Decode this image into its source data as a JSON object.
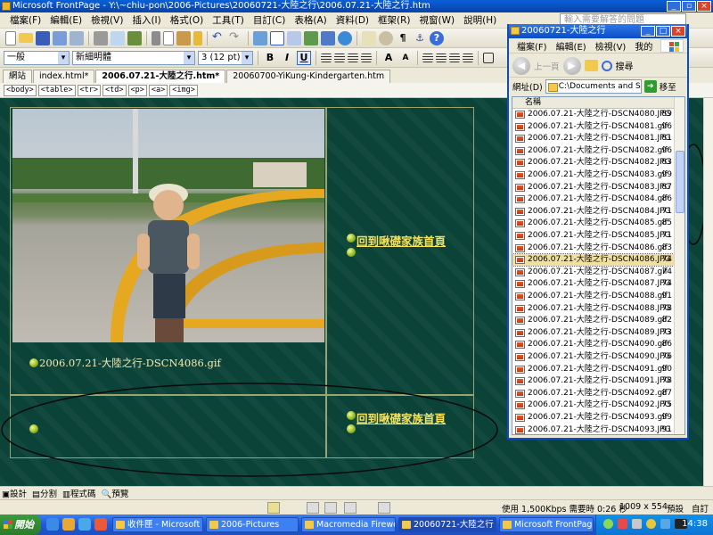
{
  "window": {
    "title": "Microsoft FrontPage - Y:\\~chiu-pon\\2006-Pictures\\20060721-大陸之行\\2006.07.21-大陸之行.htm"
  },
  "menu": {
    "items": [
      "檔案(F)",
      "編輯(E)",
      "檢視(V)",
      "插入(I)",
      "格式(O)",
      "工具(T)",
      "目訂(C)",
      "表格(A)",
      "資料(D)",
      "框架(R)",
      "視窗(W)",
      "說明(H)"
    ],
    "help_placeholder": "輸入需要解答的問題"
  },
  "format": {
    "style": "一般",
    "font": "新細明體",
    "size": "3 (12 pt)"
  },
  "tabs": [
    {
      "label": "網站"
    },
    {
      "label": "index.html*"
    },
    {
      "label": "2006.07.21-大陸之行.htm*"
    },
    {
      "label": "20060700-YiKung-Kindergarten.htm"
    }
  ],
  "tags": [
    "<body>",
    "<table>",
    "<tr>",
    "<td>",
    "<p>",
    "<a>",
    "<img>"
  ],
  "page": {
    "caption": "2006.07.21-大陸之行-DSCN4086.gif",
    "home_link": "回到啾礎家族首頁",
    "home_link2": "回到啾礎家族首頁"
  },
  "explorer": {
    "title": "20060721-大陸之行",
    "menu": [
      "檔案(F)",
      "編輯(E)",
      "檢視(V)",
      "我的"
    ],
    "back": "上一頁",
    "search": "搜尋",
    "address_label": "網址(D)",
    "address": "C:\\Documents and Set",
    "go": "移至",
    "col_name": "名稱",
    "col_size": "大",
    "files": [
      {
        "name": "2006.07.21-大陸之行-DSCN4080.JPG",
        "size": "89"
      },
      {
        "name": "2006.07.21-大陸之行-DSCN4081.gif",
        "size": "96"
      },
      {
        "name": "2006.07.21-大陸之行-DSCN4081.JPG",
        "size": "81"
      },
      {
        "name": "2006.07.21-大陸之行-DSCN4082.gif",
        "size": "96"
      },
      {
        "name": "2006.07.21-大陸之行-DSCN4082.JPG",
        "size": "83"
      },
      {
        "name": "2006.07.21-大陸之行-DSCN4083.gif",
        "size": "99"
      },
      {
        "name": "2006.07.21-大陸之行-DSCN4083.JPG",
        "size": "87"
      },
      {
        "name": "2006.07.21-大陸之行-DSCN4084.gif",
        "size": "86"
      },
      {
        "name": "2006.07.21-大陸之行-DSCN4084.JPG",
        "size": "71"
      },
      {
        "name": "2006.07.21-大陸之行-DSCN4085.gif",
        "size": "85"
      },
      {
        "name": "2006.07.21-大陸之行-DSCN4085.JPG",
        "size": "71"
      },
      {
        "name": "2006.07.21-大陸之行-DSCN4086.gif",
        "size": "83"
      },
      {
        "name": "2006.07.21-大陸之行-DSCN4086.JPG",
        "size": "74",
        "selected": true
      },
      {
        "name": "2006.07.21-大陸之行-DSCN4087.gif",
        "size": "74"
      },
      {
        "name": "2006.07.21-大陸之行-DSCN4087.JPG",
        "size": "74"
      },
      {
        "name": "2006.07.21-大陸之行-DSCN4088.gif",
        "size": "91"
      },
      {
        "name": "2006.07.21-大陸之行-DSCN4088.JPG",
        "size": "78"
      },
      {
        "name": "2006.07.21-大陸之行-DSCN4089.gif",
        "size": "82"
      },
      {
        "name": "2006.07.21-大陸之行-DSCN4089.JPG",
        "size": "73"
      },
      {
        "name": "2006.07.21-大陸之行-DSCN4090.gif",
        "size": "86"
      },
      {
        "name": "2006.07.21-大陸之行-DSCN4090.JPG",
        "size": "76"
      },
      {
        "name": "2006.07.21-大陸之行-DSCN4091.gif",
        "size": "90"
      },
      {
        "name": "2006.07.21-大陸之行-DSCN4091.JPG",
        "size": "78"
      },
      {
        "name": "2006.07.21-大陸之行-DSCN4092.gif",
        "size": "87"
      },
      {
        "name": "2006.07.21-大陸之行-DSCN4092.JPG",
        "size": "75"
      },
      {
        "name": "2006.07.21-大陸之行-DSCN4093.gif",
        "size": "99"
      },
      {
        "name": "2006.07.21-大陸之行-DSCN4093.JPG",
        "size": "91"
      }
    ]
  },
  "viewtabs": [
    "設計",
    "分割",
    "程式碼",
    "預覽"
  ],
  "status": {
    "speed": "使用 1,500Kbps 需要時 0:26 秒",
    "dims": "1009 x 554",
    "mode": "預設",
    "custom": "自訂"
  },
  "taskbar": {
    "start": "開始",
    "items": [
      {
        "label": "收件匣 - Microsoft ..."
      },
      {
        "label": "2006-Pictures"
      },
      {
        "label": "Macromedia Firewor..."
      },
      {
        "label": "20060721-大陸之行"
      },
      {
        "label": "Microsoft FrontPage ..."
      }
    ],
    "clock": "14:38"
  },
  "colors": {
    "editor_bg": "#0B4338",
    "link": "#F5E25A",
    "title_bar": "#0A5FD8"
  }
}
